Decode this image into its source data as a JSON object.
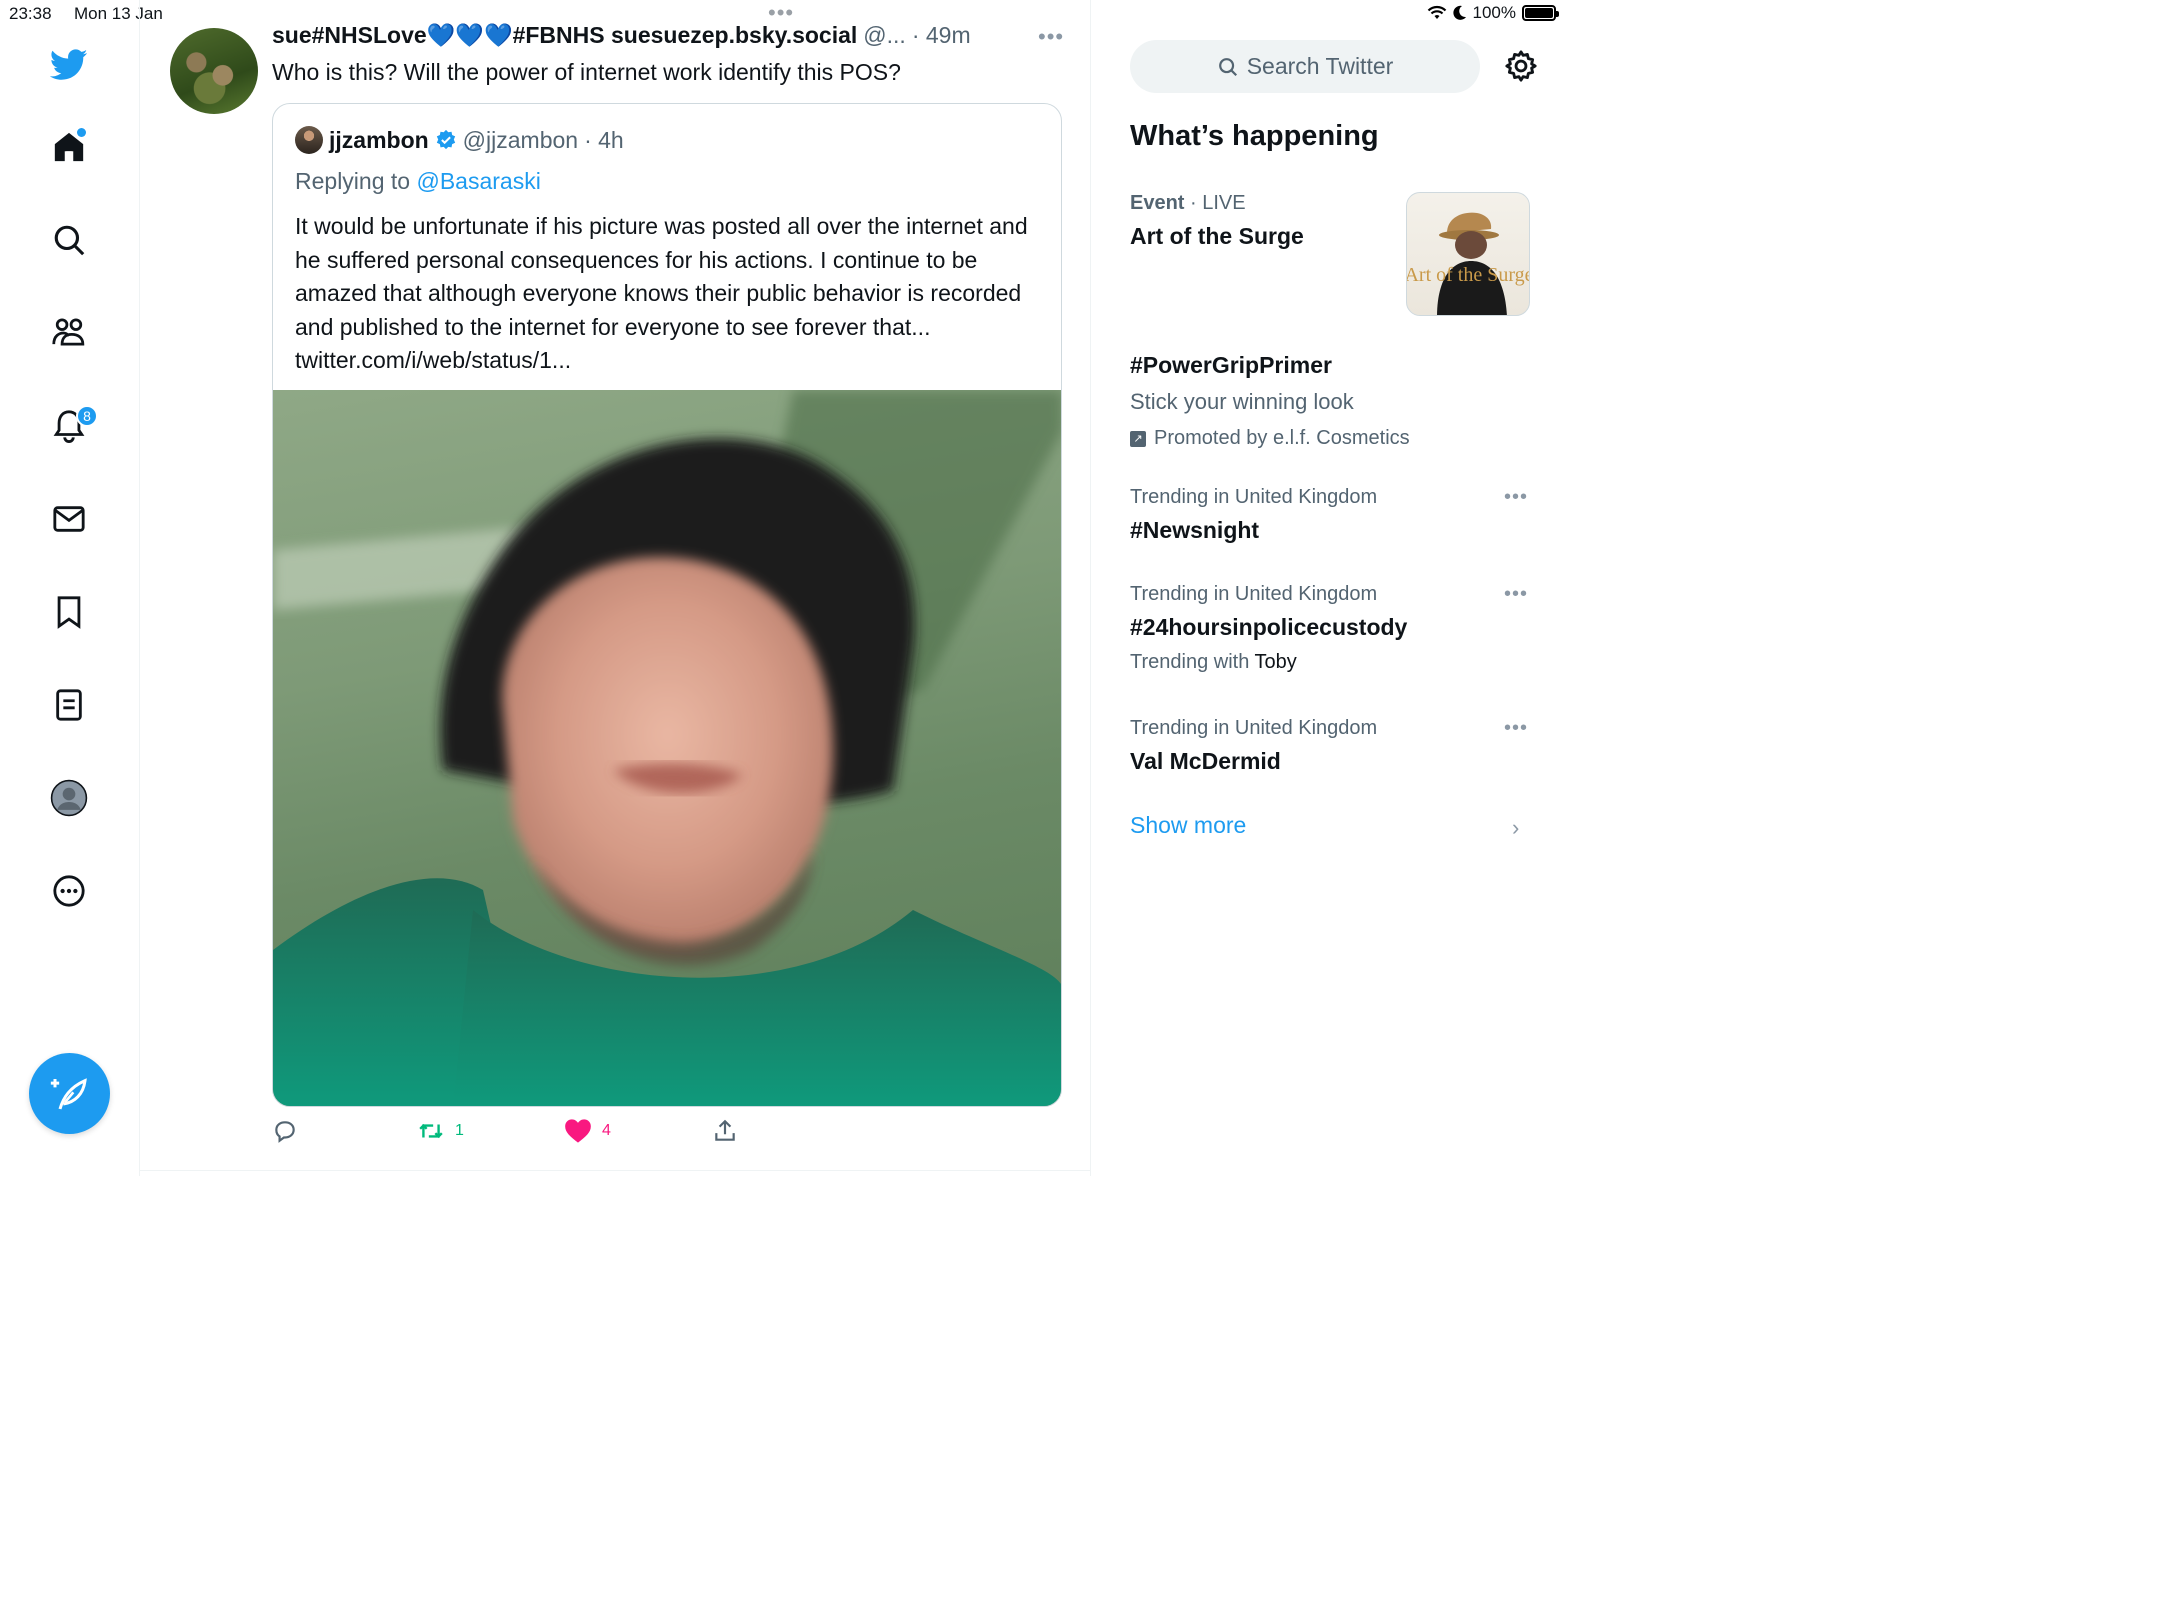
{
  "status_bar": {
    "time": "23:38",
    "date": "Mon 13 Jan",
    "battery": "100%"
  },
  "nav": {
    "notifications_badge": "8",
    "items": [
      "home-icon",
      "search-icon",
      "communities-icon",
      "notifications-icon",
      "messages-icon",
      "bookmarks-icon",
      "lists-icon",
      "profile-icon",
      "more-icon"
    ]
  },
  "tweet": {
    "display_name": "sue#NHSLove💙💙💙#FBNHS suesuezep.bsky.social",
    "handle": "@...",
    "time": "· 49m",
    "text": "Who is this? Will the power of internet work identify this POS?",
    "quote": {
      "display_name": "jjzambon",
      "handle": "@jjzambon",
      "time": "· 4h",
      "replying_prefix": "Replying to",
      "replying_to": "@Basaraski",
      "text": "It would be unfortunate if his picture was posted all over the internet and he suffered personal consequences for his actions. I continue to be amazed that although everyone knows their public behavior is recorded and published to the internet for everyone to see forever that... twitter.com/i/web/status/1..."
    },
    "retweets": "1",
    "likes": "4"
  },
  "sidebar": {
    "search_placeholder": "Search Twitter",
    "section_title": "What’s happening",
    "event": {
      "label": "Event",
      "status": "· LIVE",
      "title": "Art of the Surge",
      "thumb_text": "Art of the Surge"
    },
    "promoted": {
      "title": "#PowerGripPrimer",
      "subtitle": "Stick your winning look",
      "promoter": "Promoted by e.l.f. Cosmetics"
    },
    "trends": [
      {
        "meta": "Trending in United Kingdom",
        "title": "#Newsnight"
      },
      {
        "meta": "Trending in United Kingdom",
        "title": "#24hoursinpolicecustody",
        "with_prefix": "Trending with",
        "with": "Toby"
      },
      {
        "meta": "Trending in United Kingdom",
        "title": "Val McDermid"
      }
    ],
    "show_more": "Show more"
  },
  "colors": {
    "accent": "#1d9bf0",
    "retweet": "#00ba7c",
    "like": "#f91880",
    "muted": "#536471"
  }
}
